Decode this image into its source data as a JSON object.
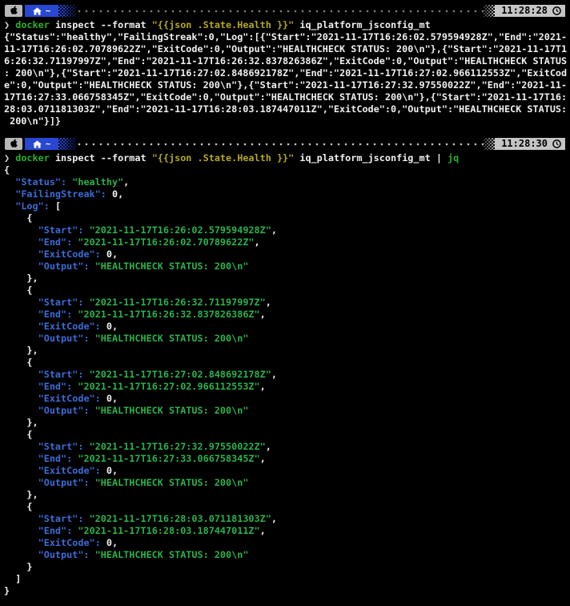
{
  "bars": [
    {
      "time": "11:28:28",
      "home": "~"
    },
    {
      "time": "11:28:30",
      "home": "~"
    }
  ],
  "panes": [
    {
      "view": "raw",
      "command": [
        {
          "c": "prompt",
          "t": "❯ "
        },
        {
          "c": "green",
          "t": "docker"
        },
        {
          "c": "plain",
          "t": " inspect --format "
        },
        {
          "c": "yellow",
          "t": "\"{{json .State.Health }}\""
        },
        {
          "c": "plain",
          "t": " iq_platform_jsconfig_mt"
        }
      ]
    },
    {
      "view": "jq",
      "command": [
        {
          "c": "prompt",
          "t": "❯ "
        },
        {
          "c": "green",
          "t": "docker"
        },
        {
          "c": "plain",
          "t": " inspect --format "
        },
        {
          "c": "yellow",
          "t": "\"{{json .State.Health }}\""
        },
        {
          "c": "plain",
          "t": " iq_platform_jsconfig_mt"
        },
        {
          "c": "plain",
          "t": " | "
        },
        {
          "c": "green",
          "t": "jq"
        }
      ]
    }
  ],
  "health": {
    "Status": "healthy",
    "FailingStreak": 0,
    "Log": [
      {
        "Start": "2021-11-17T16:26:02.579594928Z",
        "End": "2021-11-17T16:26:02.70789622Z",
        "ExitCode": 0,
        "Output": "HEALTHCHECK STATUS: 200\n"
      },
      {
        "Start": "2021-11-17T16:26:32.71197997Z",
        "End": "2021-11-17T16:26:32.837826386Z",
        "ExitCode": 0,
        "Output": "HEALTHCHECK STATUS: 200\n"
      },
      {
        "Start": "2021-11-17T16:27:02.848692178Z",
        "End": "2021-11-17T16:27:02.966112553Z",
        "ExitCode": 0,
        "Output": "HEALTHCHECK STATUS: 200\n"
      },
      {
        "Start": "2021-11-17T16:27:32.97550022Z",
        "End": "2021-11-17T16:27:33.066758345Z",
        "ExitCode": 0,
        "Output": "HEALTHCHECK STATUS: 200\n"
      },
      {
        "Start": "2021-11-17T16:28:03.071181303Z",
        "End": "2021-11-17T16:28:03.187447011Z",
        "ExitCode": 0,
        "Output": "HEALTHCHECK STATUS: 200\n"
      }
    ]
  },
  "wrap_columns": 99,
  "colors": {
    "background": "#000000",
    "text": "#f0f0f0",
    "command_green": "#28b228",
    "string_green": "#2ab34a",
    "key_blue": "#3c6cd8",
    "arg_yellow": "#b5a81f",
    "badge_blue": "#2847d2",
    "badge_grey": "#b8b8b8",
    "clock_bg": "#c5c5c5"
  },
  "icons": {
    "apple": "apple-icon",
    "home": "home-icon",
    "clock": "clock-icon"
  }
}
